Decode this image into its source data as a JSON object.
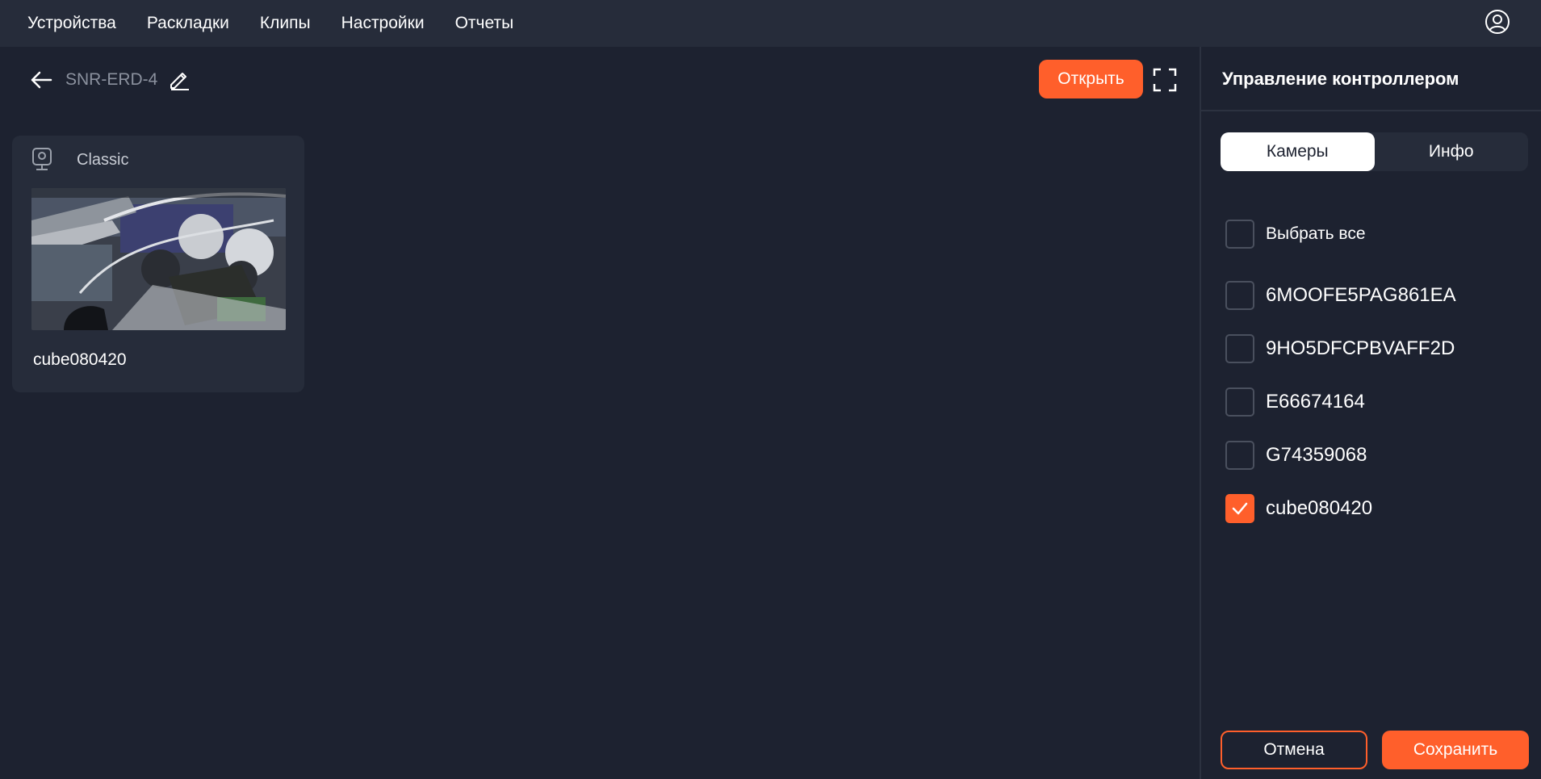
{
  "nav": {
    "items": [
      {
        "label": "Устройства"
      },
      {
        "label": "Раскладки"
      },
      {
        "label": "Клипы"
      },
      {
        "label": "Настройки"
      },
      {
        "label": "Отчеты"
      }
    ]
  },
  "header": {
    "device_name": "SNR-ERD-4",
    "open_label": "Открыть"
  },
  "card": {
    "type": "Classic",
    "name": "cube080420"
  },
  "panel": {
    "title": "Управление контроллером",
    "tabs": [
      {
        "label": "Камеры",
        "active": true
      },
      {
        "label": "Инфо",
        "active": false
      }
    ],
    "select_all_label": "Выбрать все",
    "cameras": [
      {
        "label": "6MOOFE5PAG861EA",
        "checked": false
      },
      {
        "label": "9HO5DFCPBVAFF2D",
        "checked": false
      },
      {
        "label": "E66674164",
        "checked": false
      },
      {
        "label": "G74359068",
        "checked": false
      },
      {
        "label": "cube080420",
        "checked": true
      }
    ],
    "cancel_label": "Отмена",
    "save_label": "Сохранить"
  },
  "colors": {
    "accent": "#ff5f2b",
    "background": "#1d2230",
    "surface": "#262c3a"
  }
}
